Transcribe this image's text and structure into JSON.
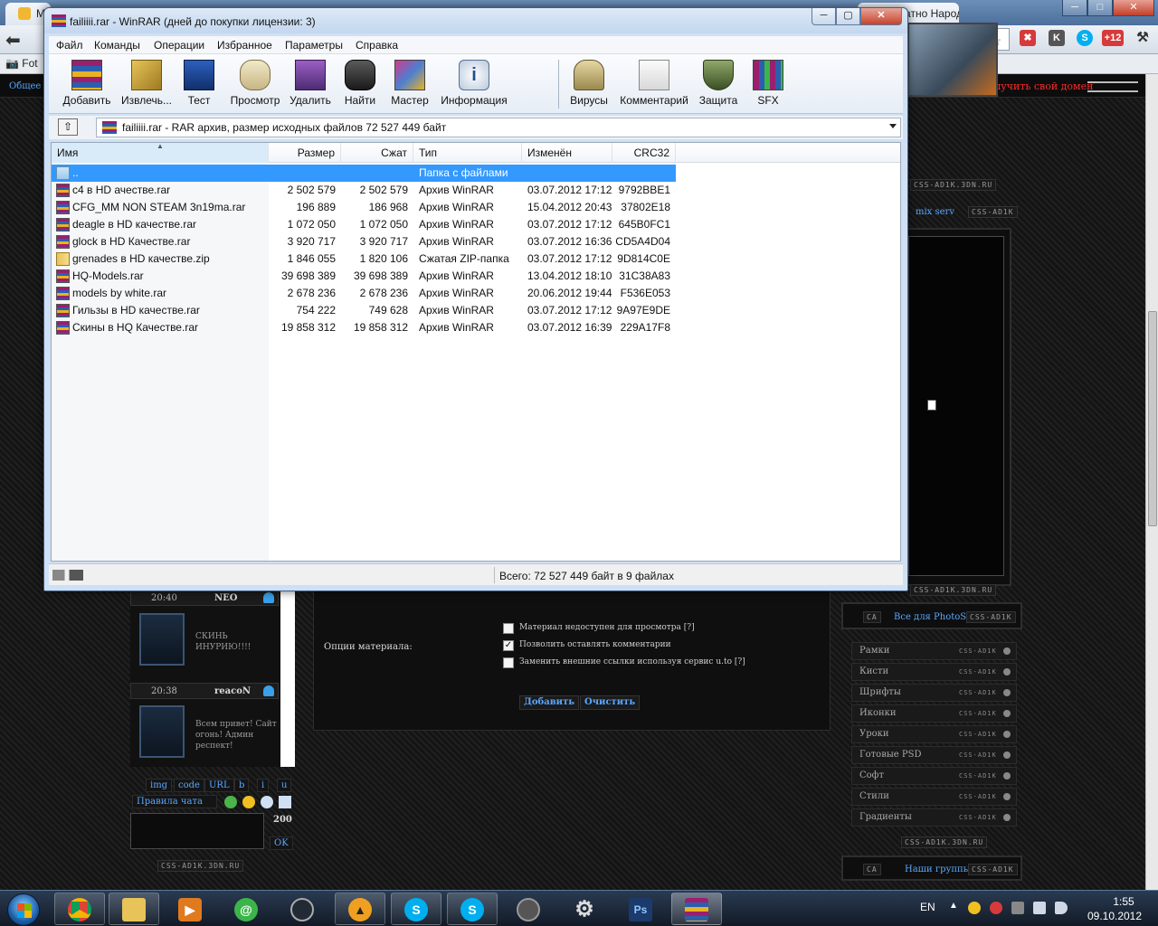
{
  "browser": {
    "tab_partial": "Ма",
    "tab_right": "Бесплатно Народ",
    "bookmark": "Fot",
    "win_min": "─",
    "win_max": "□",
    "win_close": "✕",
    "badge": "+12"
  },
  "site": {
    "top_link": "Общее",
    "domain_link": "Получить свой домен",
    "css_tag": "CSS-AD1K",
    "css_tag_url": "CSS-AD1K.3DN.RU",
    "ca_tag": "CA",
    "mix_serv": "mix serv",
    "photoshop_link": "Все для PhotoShop",
    "groups_link": "Наши группы",
    "categories": [
      "Рамки",
      "Кисти",
      "Шрифты",
      "Иконки",
      "Уроки",
      "Готовые PSD",
      "Софт",
      "Стили",
      "Градиенты"
    ],
    "chat": [
      {
        "time": "20:40",
        "nick": "NEO",
        "msg": "СКИНЬ ИНУРИЮ!!!!"
      },
      {
        "time": "20:38",
        "nick": "reacoN",
        "msg": "Всем привет! Сайт огонь! Админ респект!"
      }
    ],
    "bb_buttons": [
      "img",
      "code",
      "URL",
      "b",
      "i",
      "u"
    ],
    "chat_rules": "Правила чата",
    "chat_limit": "200",
    "chat_ok": "OK",
    "form_options_label": "Опции материала:",
    "form_checks": [
      {
        "label": "Материал недоступен для просмотра [?]",
        "checked": "",
        "checked_mark": ""
      },
      {
        "label": "Позволить оставлять комментарии",
        "checked": "true",
        "checked_mark": "✓"
      },
      {
        "label": "Заменить внешние ссылки используя сервис u.to [?]",
        "checked": "",
        "checked_mark": ""
      }
    ],
    "form_add_btn": "Добавить",
    "form_clear_btn": "Очистить"
  },
  "winrar": {
    "title": "failiiii.rar - WinRAR (дней до покупки лицензии: 3)",
    "btn_min": "─",
    "btn_max": "▢",
    "btn_close": "✕",
    "menu": [
      "Файл",
      "Команды",
      "Операции",
      "Избранное",
      "Параметры",
      "Справка"
    ],
    "toolbar": [
      "Добавить",
      "Извлечь...",
      "Тест",
      "Просмотр",
      "Удалить",
      "Найти",
      "Мастер",
      "Информация",
      "Вирусы",
      "Комментарий",
      "Защита",
      "SFX"
    ],
    "address": "failiiii.rar - RAR архив, размер исходных файлов 72 527 449 байт",
    "up_glyph": "⇧",
    "columns": {
      "name": "Имя",
      "size": "Размер",
      "packed": "Сжат",
      "type": "Тип",
      "modified": "Изменён",
      "crc": "CRC32"
    },
    "sort_indicator": "▲",
    "files": [
      {
        "name": "..",
        "size": "",
        "packed": "",
        "type": "Папка с файлами",
        "modified": "",
        "crc": "",
        "kind": "folder"
      },
      {
        "name": "c4 в HD ачестве.rar",
        "size": "2 502 579",
        "packed": "2 502 579",
        "type": "Архив WinRAR",
        "modified": "03.07.2012 17:12",
        "crc": "9792BBE1",
        "kind": "rar"
      },
      {
        "name": "CFG_MM NON STEAM 3n19ma.rar",
        "size": "196 889",
        "packed": "186 968",
        "type": "Архив WinRAR",
        "modified": "15.04.2012 20:43",
        "crc": "37802E18",
        "kind": "rar"
      },
      {
        "name": "deagle в HD качестве.rar",
        "size": "1 072 050",
        "packed": "1 072 050",
        "type": "Архив WinRAR",
        "modified": "03.07.2012 17:12",
        "crc": "645B0FC1",
        "kind": "rar"
      },
      {
        "name": "glock в HD Качестве.rar",
        "size": "3 920 717",
        "packed": "3 920 717",
        "type": "Архив WinRAR",
        "modified": "03.07.2012 16:36",
        "crc": "CD5A4D04",
        "kind": "rar"
      },
      {
        "name": "grenades в HD качестве.zip",
        "size": "1 846 055",
        "packed": "1 820 106",
        "type": "Сжатая ZIP-папка",
        "modified": "03.07.2012 17:12",
        "crc": "9D814C0E",
        "kind": "zip"
      },
      {
        "name": "HQ-Models.rar",
        "size": "39 698 389",
        "packed": "39 698 389",
        "type": "Архив WinRAR",
        "modified": "13.04.2012 18:10",
        "crc": "31C38A83",
        "kind": "rar"
      },
      {
        "name": "models by white.rar",
        "size": "2 678 236",
        "packed": "2 678 236",
        "type": "Архив WinRAR",
        "modified": "20.06.2012 19:44",
        "crc": "F536E053",
        "kind": "rar"
      },
      {
        "name": "Гильзы в HD качестве.rar",
        "size": "754 222",
        "packed": "749 628",
        "type": "Архив WinRAR",
        "modified": "03.07.2012 17:12",
        "crc": "9A97E9DE",
        "kind": "rar"
      },
      {
        "name": "Скины в HQ Качестве.rar",
        "size": "19 858 312",
        "packed": "19 858 312",
        "type": "Архив WinRAR",
        "modified": "03.07.2012 16:39",
        "crc": "229A17F8",
        "kind": "rar"
      }
    ],
    "status": "Всего: 72 527 449 байт в 9 файлах"
  },
  "taskbar": {
    "lang": "EN",
    "tray_arrow": "▲",
    "time": "1:55",
    "date": "09.10.2012",
    "apps": [
      {
        "name": "chrome-icon",
        "glyph": "",
        "color": "#db4437"
      },
      {
        "name": "explorer-icon",
        "glyph": "",
        "color": "#e8c35a"
      },
      {
        "name": "media-player-icon",
        "glyph": "▶",
        "color": "#e07a1f"
      },
      {
        "name": "mail-agent-icon",
        "glyph": "@",
        "color": "#3bb54a"
      },
      {
        "name": "steam-icon",
        "glyph": "",
        "color": "#222a35"
      },
      {
        "name": "aimp-icon",
        "glyph": "▲",
        "color": "#f0a020"
      },
      {
        "name": "skype-icon",
        "glyph": "S",
        "color": "#00aff0"
      },
      {
        "name": "skype-icon-2",
        "glyph": "S",
        "color": "#00aff0"
      },
      {
        "name": "camera-app-icon",
        "glyph": "",
        "color": "#555"
      },
      {
        "name": "gear-icon",
        "glyph": "⚙",
        "color": "#666"
      },
      {
        "name": "photoshop-icon",
        "glyph": "Ps",
        "color": "#1c3a6b"
      },
      {
        "name": "winrar-icon",
        "glyph": "",
        "color": "#9b1f6e"
      }
    ]
  }
}
